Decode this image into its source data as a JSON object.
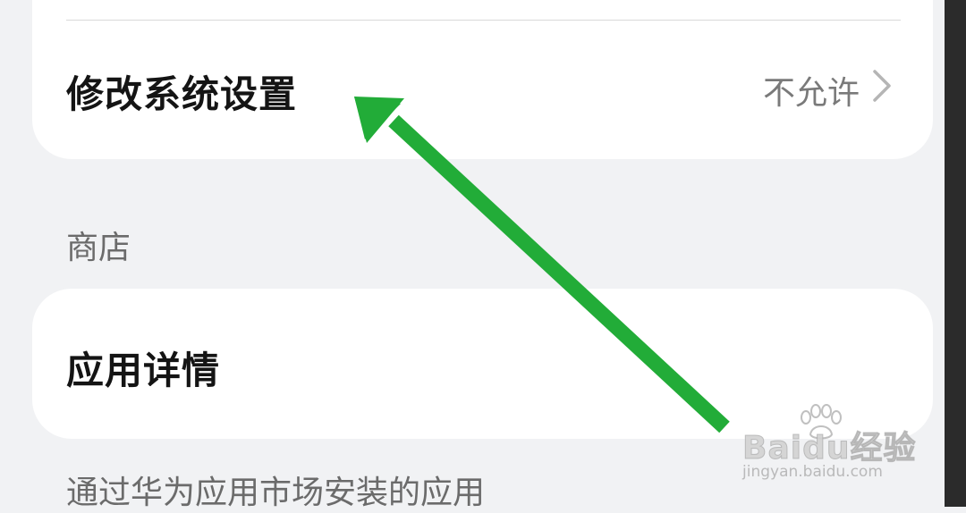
{
  "settings": {
    "modify_system_settings": {
      "label": "修改系统设置",
      "value": "不允许"
    }
  },
  "store_section": {
    "header": "商店",
    "app_details_label": "应用详情",
    "install_source": "通过华为应用市场安装的应用"
  },
  "watermark": {
    "brand_text": "Baidu经验",
    "url_text": "jingyan.baidu.com",
    "icon": "paw-icon"
  },
  "annotation": {
    "icon": "arrow-icon",
    "color": "#22ac38"
  },
  "colors": {
    "background": "#f1f2f4",
    "card": "#ffffff",
    "secondary_text": "#7a7a7a"
  }
}
